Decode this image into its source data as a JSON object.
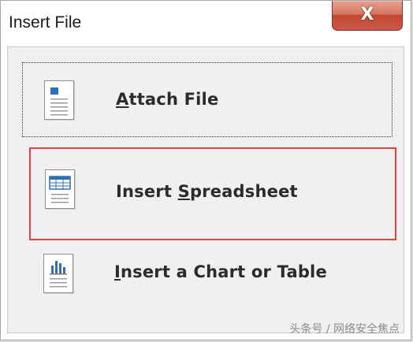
{
  "window": {
    "title": "Insert File",
    "close_symbol": "X"
  },
  "options": [
    {
      "pre": "",
      "accel": "A",
      "post": "ttach File",
      "icon": "document-icon"
    },
    {
      "pre": "Insert ",
      "accel": "S",
      "post": "preadsheet",
      "icon": "spreadsheet-icon"
    },
    {
      "pre": "",
      "accel": "I",
      "post": "nsert a Chart or Table",
      "icon": "chart-icon"
    }
  ],
  "watermark": "头条号 / 网络安全焦点",
  "colors": {
    "selection_border": "#e04040",
    "icon_blue": "#2f6fb8"
  }
}
